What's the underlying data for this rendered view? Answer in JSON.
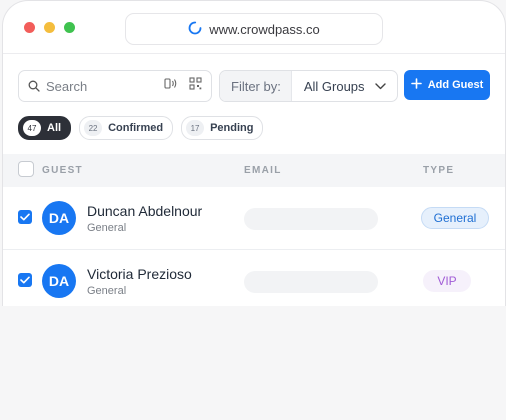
{
  "browser": {
    "url": "www.crowdpass.co"
  },
  "toolbar": {
    "search_placeholder": "Search",
    "filter_label": "Filter by:",
    "filter_value": "All Groups",
    "add_button_label": "Add Guest"
  },
  "filters": [
    {
      "count": "47",
      "label": "All",
      "active": true
    },
    {
      "count": "22",
      "label": "Confirmed",
      "active": false
    },
    {
      "count": "17",
      "label": "Pending",
      "active": false
    }
  ],
  "table": {
    "columns": [
      "GUEST",
      "EMAIL",
      "TYPE"
    ],
    "rows": [
      {
        "initials": "DA",
        "name": "Duncan Abdelnour",
        "group": "General",
        "email": "",
        "type": "General",
        "checked": true
      },
      {
        "initials": "DA",
        "name": "Victoria Prezioso",
        "group": "General",
        "email": "",
        "type": "VIP",
        "checked": true
      }
    ]
  },
  "colors": {
    "accent": "#1877f2",
    "active_pill": "#2d3038",
    "vip_text": "#a15cd6",
    "general_badge_bg": "#e6f0fc"
  }
}
